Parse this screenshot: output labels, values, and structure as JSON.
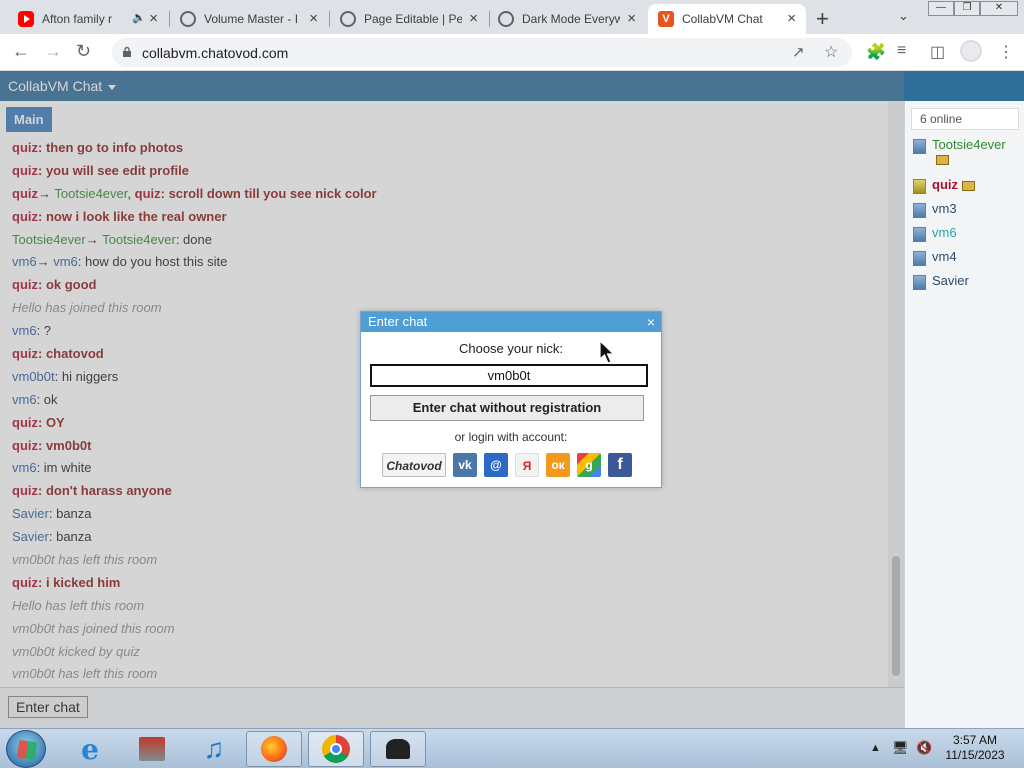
{
  "tabs": [
    {
      "title": "Afton family r",
      "icon": "youtube-icon",
      "extra": "audio-playing-icon"
    },
    {
      "title": "Volume Master - I",
      "icon": "globe-icon"
    },
    {
      "title": "Page Editable | Pe",
      "icon": "globe-icon"
    },
    {
      "title": "Dark Mode Everyw",
      "icon": "globe-icon"
    },
    {
      "title": "CollabVM Chat",
      "icon": "collabvm-icon",
      "active": true
    }
  ],
  "address": {
    "url": "collabvm.chatovod.com"
  },
  "app": {
    "title": "CollabVM Chat",
    "room_tab": "Main"
  },
  "messages": [
    {
      "parts": [
        {
          "t": "quiz",
          "c": "quiz"
        },
        {
          "t": ": then go to info photos",
          "c": "bold"
        }
      ]
    },
    {
      "parts": [
        {
          "t": "quiz",
          "c": "quiz"
        },
        {
          "t": ": you will see edit profile",
          "c": "bold"
        }
      ]
    },
    {
      "parts": [
        {
          "t": "quiz",
          "c": "quiz"
        },
        {
          "t": "→ ",
          "c": ""
        },
        {
          "t": "Tootsie4ever",
          "c": "green"
        },
        {
          "t": ", ",
          "c": ""
        },
        {
          "t": "quiz",
          "c": "quiz"
        },
        {
          "t": ": scroll down till you see nick color",
          "c": "bold"
        }
      ]
    },
    {
      "parts": [
        {
          "t": "quiz",
          "c": "quiz"
        },
        {
          "t": ": now i look like the real owner",
          "c": "bold"
        }
      ]
    },
    {
      "parts": [
        {
          "t": "Tootsie4ever",
          "c": "green"
        },
        {
          "t": "→ ",
          "c": ""
        },
        {
          "t": "Tootsie4ever",
          "c": "green"
        },
        {
          "t": ": done",
          "c": ""
        }
      ]
    },
    {
      "parts": [
        {
          "t": "vm6",
          "c": "blue"
        },
        {
          "t": "→ ",
          "c": ""
        },
        {
          "t": "vm6",
          "c": "blue"
        },
        {
          "t": ": how do you host this site",
          "c": ""
        }
      ]
    },
    {
      "parts": [
        {
          "t": "quiz",
          "c": "quiz"
        },
        {
          "t": ": ok good",
          "c": "bold"
        }
      ]
    },
    {
      "parts": [
        {
          "t": "Hello has joined this room",
          "c": "sys"
        }
      ]
    },
    {
      "parts": [
        {
          "t": "vm6",
          "c": "blue"
        },
        {
          "t": ": ?",
          "c": ""
        }
      ]
    },
    {
      "parts": [
        {
          "t": "quiz",
          "c": "quiz"
        },
        {
          "t": ": chatovod",
          "c": "bold"
        }
      ]
    },
    {
      "parts": [
        {
          "t": "vm0b0t",
          "c": "blue"
        },
        {
          "t": ": hi niggers",
          "c": ""
        }
      ]
    },
    {
      "parts": [
        {
          "t": "vm6",
          "c": "blue"
        },
        {
          "t": ": ok",
          "c": ""
        }
      ]
    },
    {
      "parts": [
        {
          "t": "quiz",
          "c": "quiz"
        },
        {
          "t": ": OY",
          "c": "bold"
        }
      ]
    },
    {
      "parts": [
        {
          "t": "quiz",
          "c": "quiz"
        },
        {
          "t": ": vm0b0t",
          "c": "bold"
        }
      ]
    },
    {
      "parts": [
        {
          "t": "vm6",
          "c": "blue"
        },
        {
          "t": ": im white",
          "c": ""
        }
      ]
    },
    {
      "parts": [
        {
          "t": "quiz",
          "c": "quiz"
        },
        {
          "t": ": don't harass anyone",
          "c": "bold"
        }
      ]
    },
    {
      "parts": [
        {
          "t": "Savier",
          "c": "blue"
        },
        {
          "t": ": banza",
          "c": ""
        }
      ]
    },
    {
      "parts": [
        {
          "t": "Savier",
          "c": "blue"
        },
        {
          "t": ": banza",
          "c": ""
        }
      ]
    },
    {
      "parts": [
        {
          "t": "vm0b0t has left this room",
          "c": "sys"
        }
      ]
    },
    {
      "parts": [
        {
          "t": "quiz",
          "c": "quiz"
        },
        {
          "t": ": i kicked him",
          "c": "bold"
        }
      ]
    },
    {
      "parts": [
        {
          "t": "Hello has left this room",
          "c": "sys"
        }
      ]
    },
    {
      "parts": [
        {
          "t": "vm0b0t has joined this room",
          "c": "sys"
        }
      ]
    },
    {
      "parts": [
        {
          "t": "vm0b0t kicked by quiz",
          "c": "sys"
        }
      ]
    },
    {
      "parts": [
        {
          "t": "vm0b0t has left this room",
          "c": "sys"
        }
      ]
    }
  ],
  "users": {
    "online_label": "6 online",
    "list": [
      {
        "name": "Tootsie4ever",
        "style": "green",
        "badge": true
      },
      {
        "name": "quiz",
        "style": "quiz",
        "badge": true,
        "gold": true
      },
      {
        "name": "vm3",
        "style": "vm"
      },
      {
        "name": "vm6",
        "style": "teal"
      },
      {
        "name": "vm4",
        "style": "vm"
      },
      {
        "name": "Savier",
        "style": "vm"
      }
    ]
  },
  "bottom": {
    "enter_chat_label": "Enter chat"
  },
  "dialog": {
    "title": "Enter chat",
    "close": "×",
    "prompt": "Choose your nick:",
    "nick_value": "vm0b0t",
    "enter_button": "Enter chat without registration",
    "or_label": "or login with account:",
    "login_options": [
      "Chatovod",
      "vk",
      "mail.ru",
      "yandex",
      "odnoklassniki",
      "google",
      "facebook"
    ]
  },
  "taskbar": {
    "apps": [
      "start-orb",
      "internet-explorer",
      "control-panel",
      "itunes",
      "firefox",
      "chrome",
      "hat-app"
    ],
    "time": "3:57 AM",
    "date": "11/15/2023"
  }
}
